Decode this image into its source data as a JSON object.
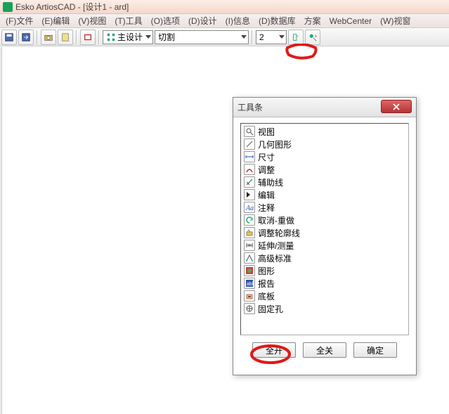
{
  "app": {
    "title": "Esko ArtiosCAD - [设计1 - ard]"
  },
  "menu": {
    "items": [
      "(F)文件",
      "(E)编辑",
      "(V)视图",
      "(T)工具",
      "(O)选项",
      "(D)设计",
      "(I)信息",
      "(D)数据库",
      "方案",
      "WebCenter",
      "(W)视窗"
    ]
  },
  "toolbar": {
    "main_design_label": "主设计",
    "combo1_value": "切割",
    "combo2_value": "2"
  },
  "dialog": {
    "title": "工具条",
    "items": [
      "视图",
      "几何图形",
      "尺寸",
      "调整",
      "辅助线",
      "编辑",
      "注释",
      "取消-重做",
      "调整轮廓线",
      "延伸/测量",
      "高级标准",
      "图形",
      "报告",
      "底板",
      "固定孔"
    ],
    "buttons": {
      "open_all": "全开",
      "close_all": "全关",
      "ok": "确定"
    }
  }
}
